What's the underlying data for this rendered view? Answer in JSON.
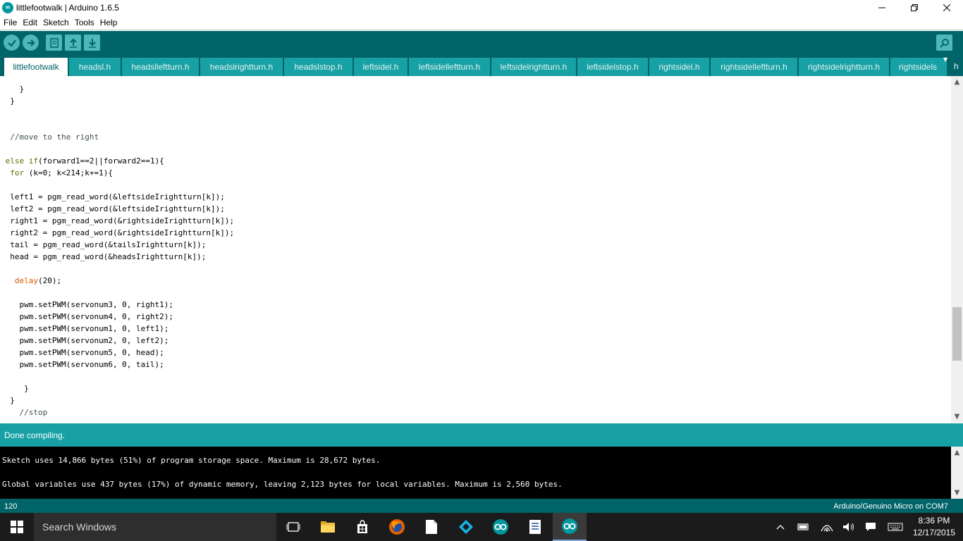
{
  "window": {
    "title": "littlefootwalk | Arduino 1.6.5",
    "app_icon": "arduino-infinity-icon",
    "minimize_icon": "minimize-icon",
    "maximize_icon": "restore-icon",
    "close_icon": "close-icon"
  },
  "menu": [
    "File",
    "Edit",
    "Sketch",
    "Tools",
    "Help"
  ],
  "toolbar": {
    "buttons": [
      "verify-icon",
      "upload-icon",
      "new-icon",
      "open-icon",
      "save-icon"
    ],
    "serial_monitor_icon": "serial-monitor-icon"
  },
  "tabs": [
    "littlefootwalk",
    "headsl.h",
    "headslleftturn.h",
    "headslrightturn.h",
    "headslstop.h",
    "leftsidel.h",
    "leftsidelleftturn.h",
    "leftsidelrightturn.h",
    "leftsidelstop.h",
    "rightsidel.h",
    "rightsidelleftturn.h",
    "rightsidelrightturn.h",
    "rightsidels"
  ],
  "tab_overflow": "h",
  "code": [
    "    }",
    "  }",
    "",
    "",
    "  //move to the right",
    "",
    " else if(forward1==2||forward2==1){",
    "  for (k=0; k<214;k+=1){",
    "",
    "  left1 = pgm_read_word(&leftsideIrightturn[k]);",
    "  left2 = pgm_read_word(&leftsideIrightturn[k]);",
    "  right1 = pgm_read_word(&rightsideIrightturn[k]);",
    "  right2 = pgm_read_word(&rightsideIrightturn[k]);",
    "  tail = pgm_read_word(&tailsIrightturn[k]);",
    "  head = pgm_read_word(&headsIrightturn[k]);",
    "",
    "   delay(20);",
    "",
    "    pwm.setPWM(servonum3, 0, right1);",
    "    pwm.setPWM(servonum4, 0, right2);",
    "    pwm.setPWM(servonum1, 0, left1);",
    "    pwm.setPWM(servonum2, 0, left2);",
    "    pwm.setPWM(servonum5, 0, head);",
    "    pwm.setPWM(servonum6, 0, tail);",
    "",
    "     }",
    "  }",
    "    //stop"
  ],
  "status": {
    "message": "Done compiling."
  },
  "console": [
    "Sketch uses 14,866 bytes (51%) of program storage space. Maximum is 28,672 bytes.",
    "",
    "Global variables use 437 bytes (17%) of dynamic memory, leaving 2,123 bytes for local variables. Maximum is 2,560 bytes."
  ],
  "bottom": {
    "line_number": "120",
    "board": "Arduino/Genuino Micro on COM7"
  },
  "taskbar": {
    "search_placeholder": "Search Windows",
    "apps": [
      "task-view-icon",
      "file-explorer-icon",
      "store-icon",
      "firefox-icon",
      "document-icon",
      "kodi-icon",
      "arduino-icon",
      "notepad-icon",
      "arduino-active-icon"
    ],
    "time": "8:36 PM",
    "date": "12/17/2015"
  },
  "colors": {
    "toolbar": "#006468",
    "tab": "#17a1a5",
    "status": "#17a1a5",
    "keyword": "#5e6d03",
    "function": "#d35400"
  }
}
